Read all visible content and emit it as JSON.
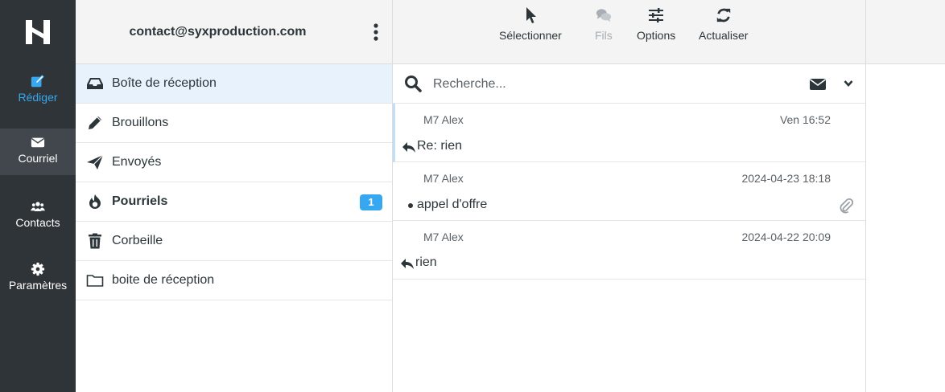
{
  "nav": {
    "compose": "Rédiger",
    "mail": "Courriel",
    "contacts": "Contacts",
    "settings": "Paramètres"
  },
  "account": {
    "email": "contact@syxproduction.com"
  },
  "folders": [
    {
      "name": "Boîte de réception",
      "icon": "inbox-icon"
    },
    {
      "name": "Brouillons",
      "icon": "pencil-icon"
    },
    {
      "name": "Envoyés",
      "icon": "paper-plane-icon"
    },
    {
      "name": "Pourriels",
      "icon": "fire-icon",
      "unread": "1"
    },
    {
      "name": "Corbeille",
      "icon": "trash-icon"
    },
    {
      "name": "boite de réception",
      "icon": "folder-icon"
    }
  ],
  "toolbar": {
    "select": "Sélectionner",
    "threads": "Fils",
    "options": "Options",
    "refresh": "Actualiser"
  },
  "search": {
    "placeholder": "Recherche..."
  },
  "messages": [
    {
      "sender": "M7 Alex",
      "date": "Ven 16:52",
      "subject": "Re: rien",
      "status": "replied"
    },
    {
      "sender": "M7 Alex",
      "date": "2024-04-23 18:18",
      "subject": "appel d'offre",
      "status": "unread",
      "attachment": true
    },
    {
      "sender": "M7 Alex",
      "date": "2024-04-22 20:09",
      "subject": "rien",
      "status": "replied"
    }
  ],
  "colors": {
    "rail": "#2f3439",
    "accent": "#37a8f0",
    "selected": "#e8f2fc"
  }
}
